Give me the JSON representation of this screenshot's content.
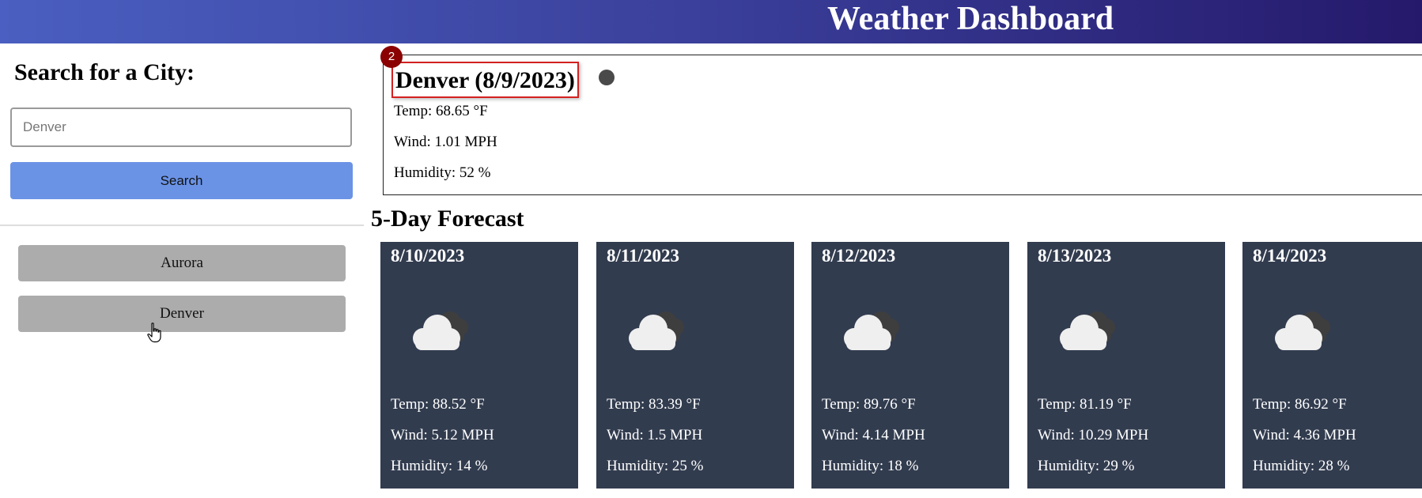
{
  "header": {
    "title": "Weather Dashboard"
  },
  "sidebar": {
    "heading": "Search for a City:",
    "search_placeholder": "Denver",
    "search_value": "",
    "search_button_label": "Search",
    "history": [
      "Aurora",
      "Denver"
    ]
  },
  "current": {
    "title": "Denver (8/9/2023)",
    "badge": "2",
    "icon": "weather-icon",
    "temp": "Temp: 68.65 °F",
    "wind": "Wind: 1.01 MPH",
    "humidity": "Humidity: 52 %"
  },
  "forecast": {
    "heading": "5-Day Forecast",
    "days": [
      {
        "date": "8/10/2023",
        "icon": "cloudy-icon",
        "temp": "Temp: 88.52 °F",
        "wind": "Wind: 5.12 MPH",
        "humidity": "Humidity: 14 %"
      },
      {
        "date": "8/11/2023",
        "icon": "cloudy-icon",
        "temp": "Temp: 83.39 °F",
        "wind": "Wind: 1.5 MPH",
        "humidity": "Humidity: 25 %"
      },
      {
        "date": "8/12/2023",
        "icon": "cloudy-icon",
        "temp": "Temp: 89.76 °F",
        "wind": "Wind: 4.14 MPH",
        "humidity": "Humidity: 18 %"
      },
      {
        "date": "8/13/2023",
        "icon": "cloudy-icon",
        "temp": "Temp: 81.19 °F",
        "wind": "Wind: 10.29 MPH",
        "humidity": "Humidity: 29 %"
      },
      {
        "date": "8/14/2023",
        "icon": "cloudy-icon",
        "temp": "Temp: 86.92 °F",
        "wind": "Wind: 4.36 MPH",
        "humidity": "Humidity: 28 %"
      }
    ]
  },
  "colors": {
    "header_gradient_start": "#4a5fc1",
    "header_gradient_end": "#25196b",
    "search_button": "#6a93e6",
    "history_button": "#acacac",
    "card_background": "#323c4f",
    "highlight_border": "#d42020",
    "badge": "#8b0000"
  }
}
